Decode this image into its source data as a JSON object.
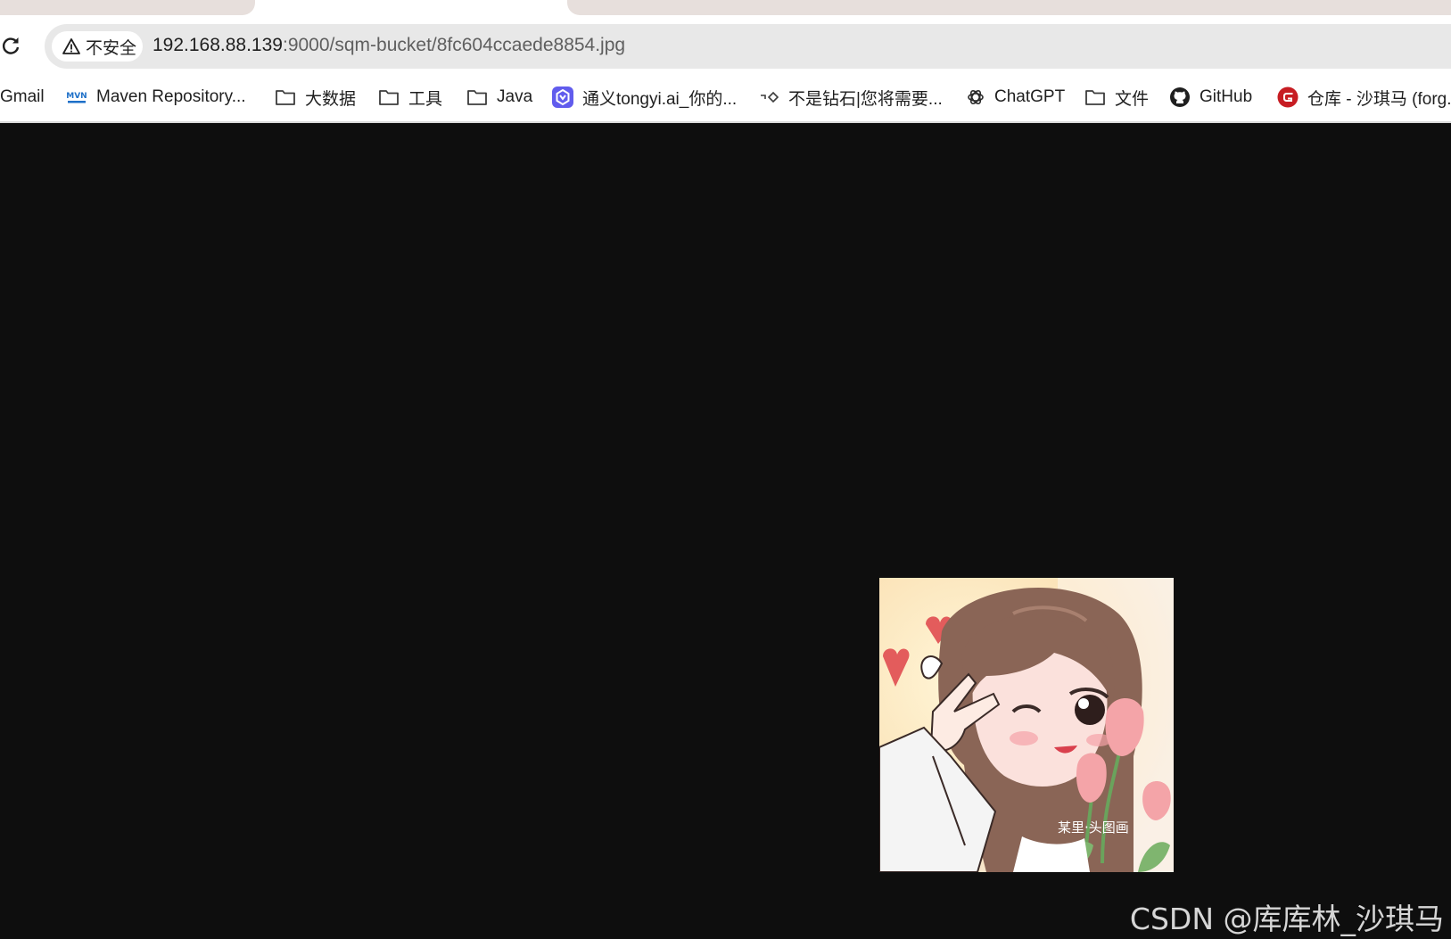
{
  "address_bar": {
    "security_label": "不安全",
    "url_host": "192.168.88.139",
    "url_rest": ":9000/sqm-bucket/8fc604ccaede8854.jpg"
  },
  "bookmarks": [
    {
      "label": "Gmail",
      "icon": "none"
    },
    {
      "label": "Maven Repository...",
      "icon": "maven-icon"
    },
    {
      "label": "大数据",
      "icon": "folder-icon"
    },
    {
      "label": "工具",
      "icon": "folder-icon"
    },
    {
      "label": "Java",
      "icon": "folder-icon"
    },
    {
      "label": "通义tongyi.ai_你的...",
      "icon": "tongyi-icon"
    },
    {
      "label": "不是钻石|您将需要...",
      "icon": "arrow-diamond-icon"
    },
    {
      "label": "ChatGPT",
      "icon": "chatgpt-icon"
    },
    {
      "label": "文件",
      "icon": "folder-icon"
    },
    {
      "label": "GitHub",
      "icon": "github-icon"
    },
    {
      "label": "仓库 - 沙琪马 (forg...",
      "icon": "gitee-icon"
    }
  ],
  "page": {
    "image_alt": "8fc604ccaede8854.jpg",
    "image_watermark": "某里·头图画",
    "watermark": "CSDN @库库林_沙琪马"
  },
  "colors": {
    "page_background": "#0e0e0e",
    "tab_inactive": "#e7dfdc",
    "omnibox": "#e8e8e8"
  }
}
